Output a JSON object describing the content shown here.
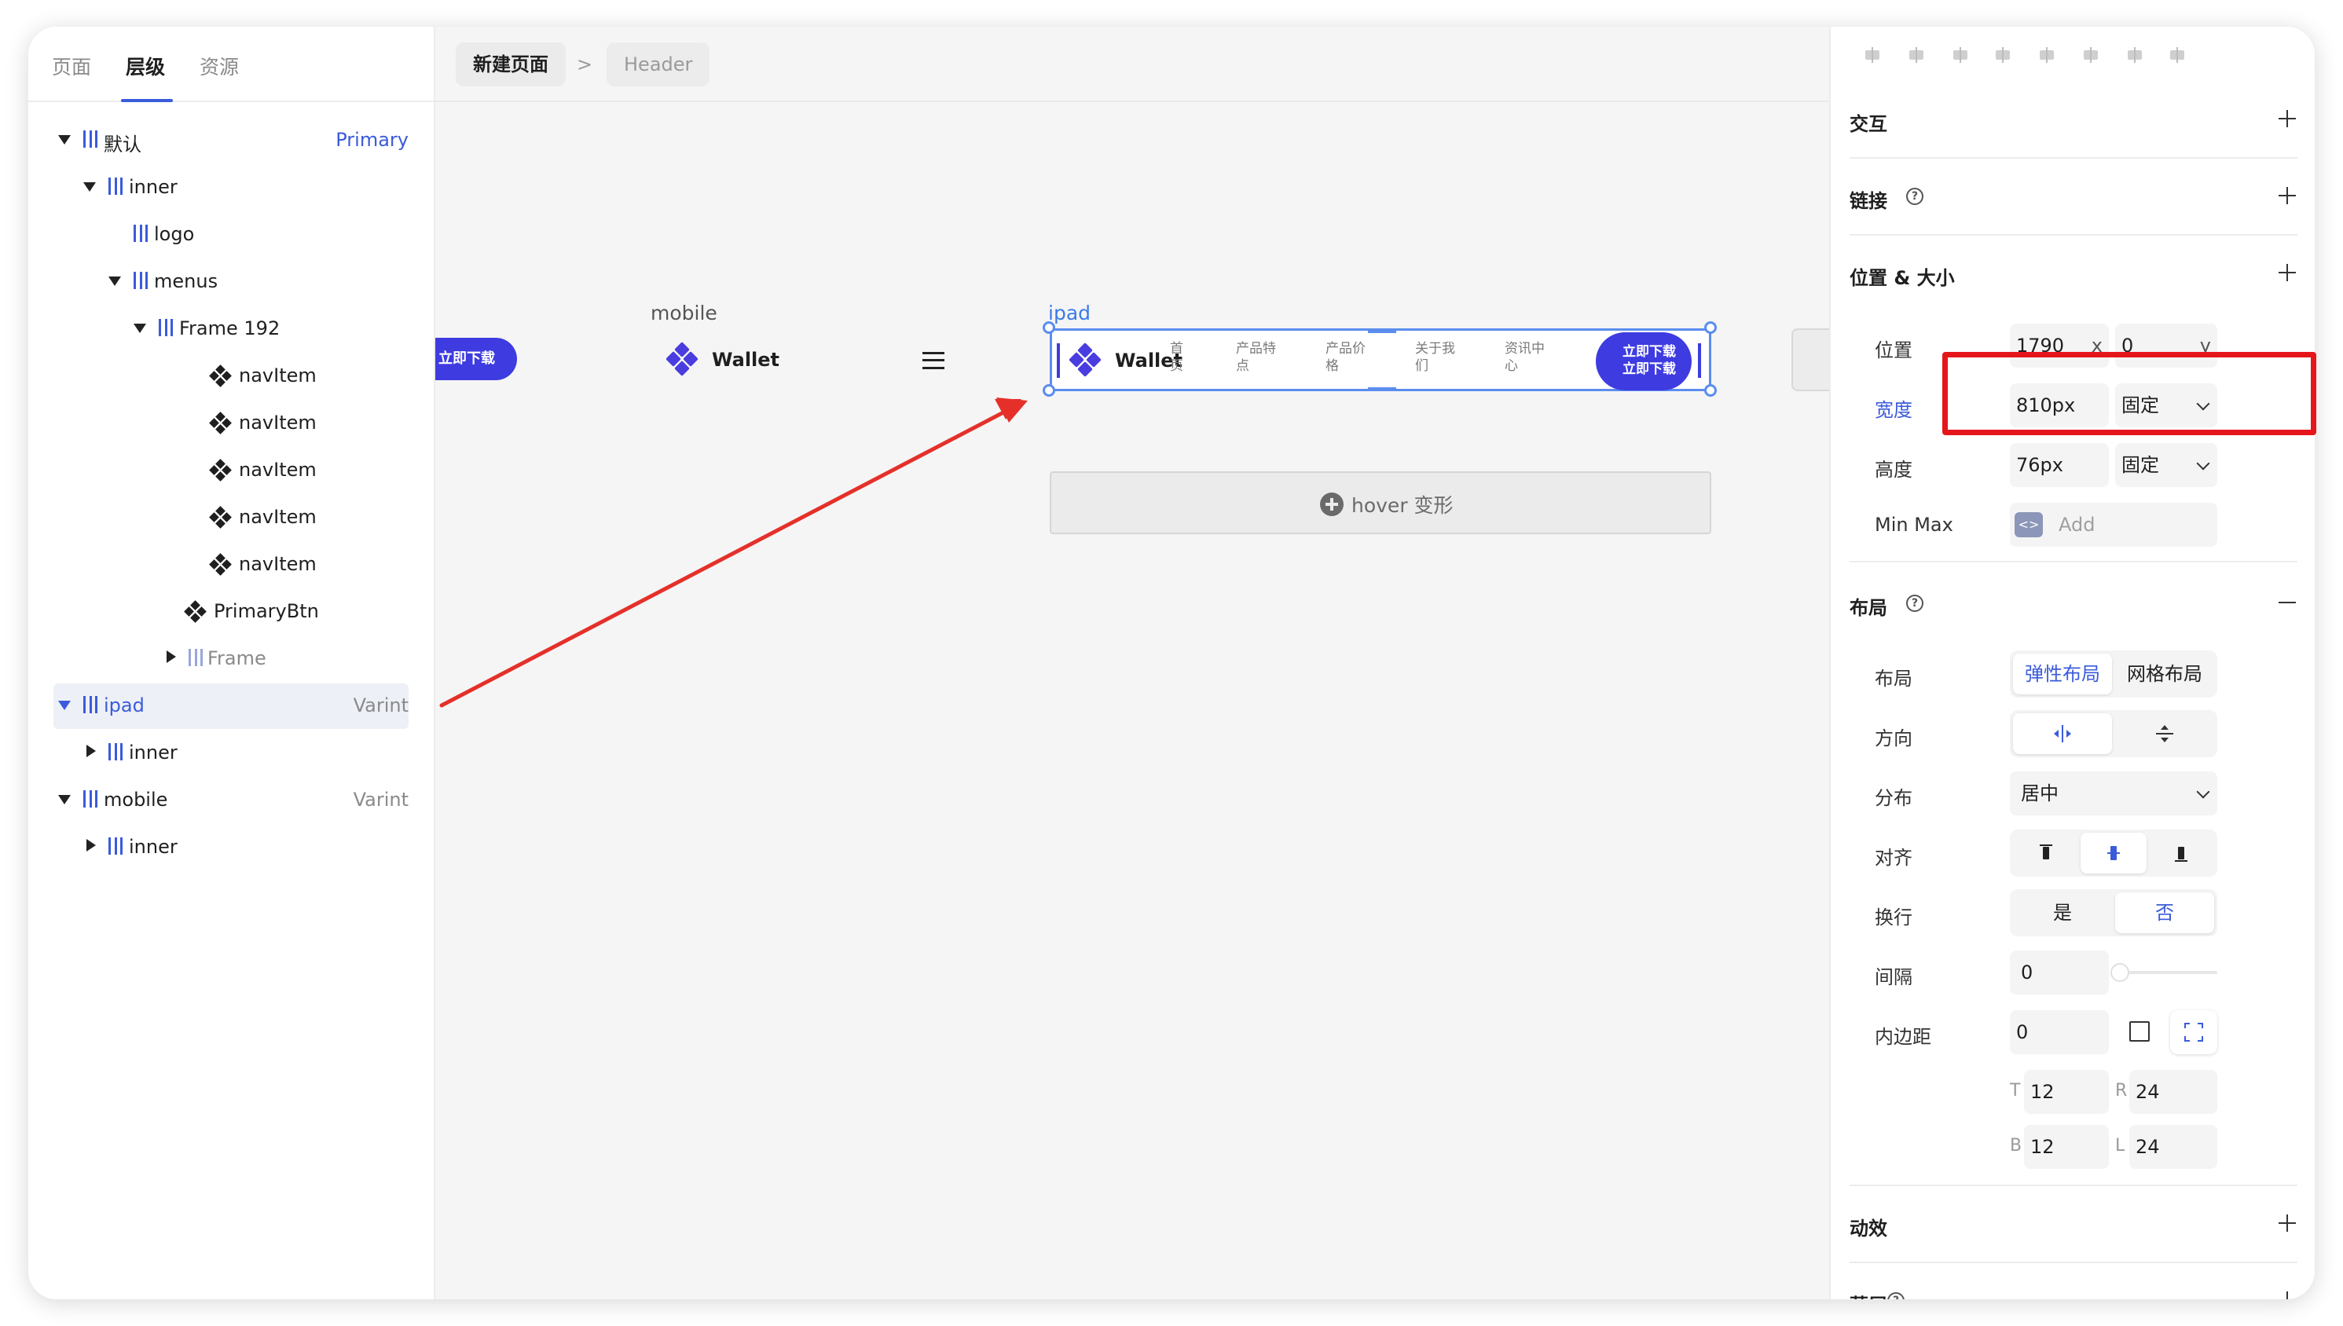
{
  "left_panel": {
    "tabs": [
      {
        "label": "页面",
        "active": false
      },
      {
        "label": "层级",
        "active": true
      },
      {
        "label": "资源",
        "active": false
      }
    ],
    "tree": [
      {
        "label": "默认",
        "tag": "Primary"
      },
      {
        "label": "inner",
        "tag": ""
      },
      {
        "label": "logo",
        "tag": ""
      },
      {
        "label": "menus",
        "tag": ""
      },
      {
        "label": "Frame 192",
        "tag": ""
      },
      {
        "label": "navItem",
        "tag": ""
      },
      {
        "label": "navItem",
        "tag": ""
      },
      {
        "label": "navItem",
        "tag": ""
      },
      {
        "label": "navItem",
        "tag": ""
      },
      {
        "label": "navItem",
        "tag": ""
      },
      {
        "label": "PrimaryBtn",
        "tag": ""
      },
      {
        "label": "Frame",
        "tag": ""
      },
      {
        "label": "ipad",
        "tag": "Varint"
      },
      {
        "label": "inner",
        "tag": ""
      },
      {
        "label": "mobile",
        "tag": "Varint"
      },
      {
        "label": "inner",
        "tag": ""
      }
    ]
  },
  "canvas": {
    "breadcrumb": [
      "新建页面",
      "Header"
    ],
    "breadcrumb_sep": ">",
    "mobile": {
      "label": "mobile",
      "button_label": "立即下载",
      "brand": "Wallet"
    },
    "ipad": {
      "label": "ipad",
      "brand": "Wallet",
      "nav_items": [
        "首页",
        "产品特点",
        "产品价格",
        "关于我们",
        "资讯中心"
      ],
      "button_label": "立即下载 立即下载"
    },
    "hover_button": "hover 变形",
    "colors": {
      "accent": "#3e3be0",
      "selection": "#5b8def",
      "annotation_red": "#e5161b"
    }
  },
  "right_panel": {
    "sections": {
      "interaction": "交互",
      "link": "链接",
      "position_size": "位置 & 大小",
      "layout": "布局",
      "effects": "动效",
      "mask": "蒙层"
    },
    "position": {
      "label": "位置",
      "x": "1790",
      "x_suffix": "x",
      "y": "0",
      "y_suffix": "y"
    },
    "width": {
      "label": "宽度",
      "value": "810px",
      "mode": "固定"
    },
    "height": {
      "label": "高度",
      "value": "76px",
      "mode": "固定"
    },
    "minmax": {
      "label": "Min Max",
      "placeholder": "Add",
      "icon": "<>"
    },
    "layout": {
      "layout_label": "布局",
      "layout_options": [
        "弹性布局",
        "网格布局"
      ],
      "direction_label": "方向",
      "distribution_label": "分布",
      "distribution_value": "居中",
      "align_label": "对齐",
      "wrap_label": "换行",
      "wrap_options": [
        "是",
        "否"
      ],
      "gap_label": "间隔",
      "gap_value": "0",
      "padding_label": "内边距",
      "padding_value": "0",
      "padding": {
        "T": "12",
        "R": "24",
        "B": "12",
        "L": "24"
      }
    }
  }
}
